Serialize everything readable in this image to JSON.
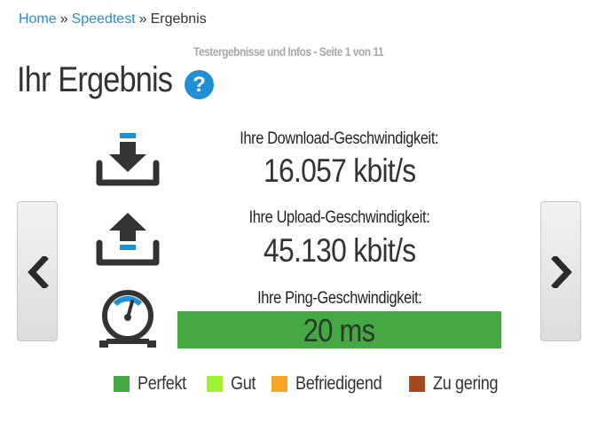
{
  "breadcrumb": {
    "home": "Home",
    "speedtest": "Speedtest",
    "current": "Ergebnis",
    "separator": "»"
  },
  "subtitle": "Testergebnisse und Infos - Seite 1 von 11",
  "title": "Ihr Ergebnis",
  "help_icon": "?",
  "download": {
    "label": "Ihre Download-Geschwindigkeit:",
    "value": "16.057 kbit/s",
    "icon": "download-tray-icon"
  },
  "upload": {
    "label": "Ihre Upload-Geschwindigkeit:",
    "value": "45.130 kbit/s",
    "icon": "upload-tray-icon"
  },
  "ping": {
    "label": "Ihre Ping-Geschwindigkeit:",
    "value": "20 ms",
    "icon": "gauge-icon",
    "rating": "Perfekt",
    "bar_color": "#45a843"
  },
  "legend": [
    {
      "label": "Perfekt",
      "color": "#45a843"
    },
    {
      "label": "Gut",
      "color": "#9ef232"
    },
    {
      "label": "Befriedigend",
      "color": "#f6a623"
    },
    {
      "label": "Zu gering",
      "color": "#a54a1f"
    }
  ],
  "colors": {
    "accent": "#2a8ad6",
    "icon_dark": "#333333",
    "icon_blue": "#1f8fd6"
  }
}
